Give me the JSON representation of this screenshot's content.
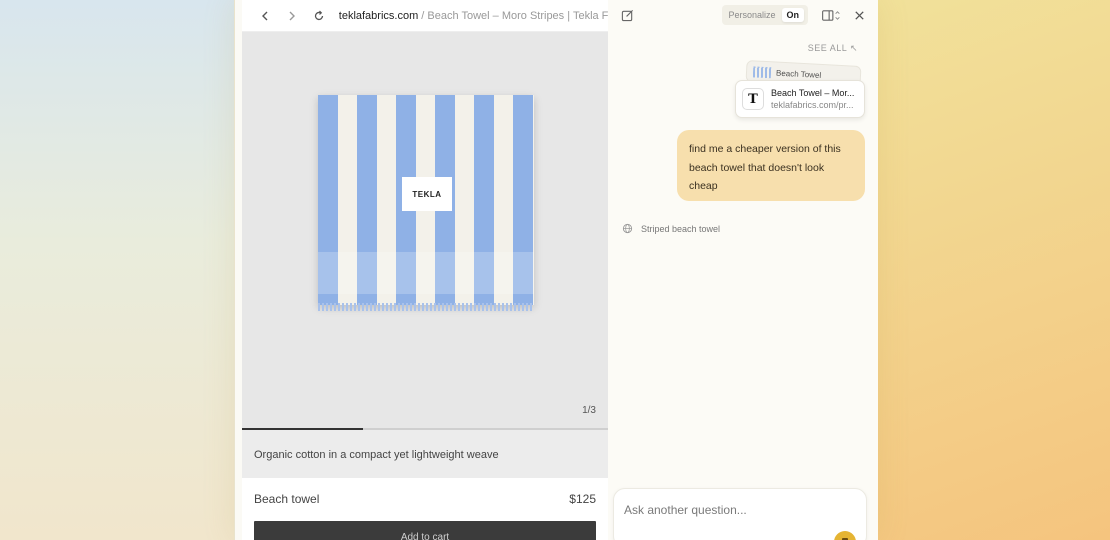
{
  "browser": {
    "url_domain": "teklafabrics.com",
    "url_separator": " / ",
    "url_title": "Beach Towel – Moro Stripes | Tekla F..."
  },
  "product": {
    "tag_label": "TEKLA",
    "image_counter": "1/3",
    "gallery_progress": 0.33,
    "description": "Organic cotton in a compact yet lightweight weave",
    "name": "Beach towel",
    "price": "$125",
    "add_to_cart_label": "Add to cart"
  },
  "assistant": {
    "personalize_label": "Personalize",
    "personalize_state": "On",
    "see_all_label": "SEE ALL",
    "context_card_back_title": "Beach Towel",
    "context_card": {
      "favicon_letter": "T",
      "title": "Beach Towel – Mor...",
      "url": "teklafabrics.com/pr..."
    },
    "user_message": "find me a cheaper version of this beach towel that doesn't look cheap",
    "step_label": "Striped beach towel",
    "input_placeholder": "Ask another question..."
  },
  "colors": {
    "stripe_blue": "#8fb1e6",
    "user_bubble": "#f7dfad",
    "send_button": "#e5b433"
  }
}
